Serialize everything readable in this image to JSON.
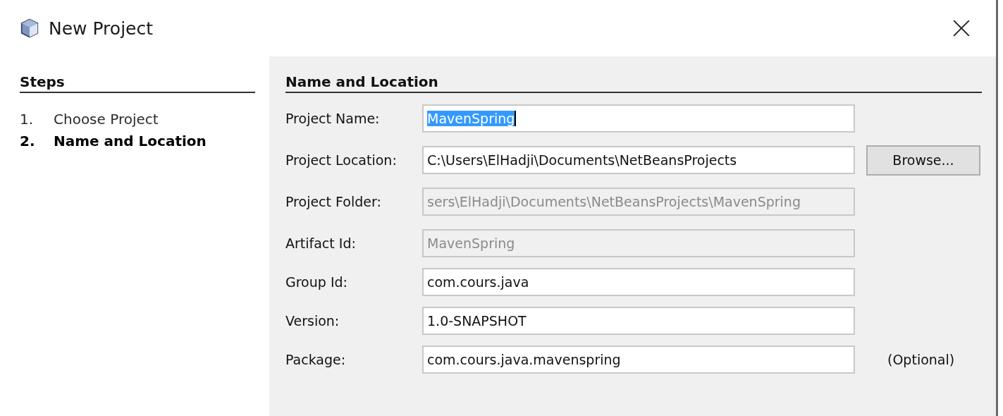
{
  "window": {
    "title": "New Project"
  },
  "steps": {
    "title": "Steps",
    "items": [
      {
        "number": "1.",
        "label": "Choose Project",
        "selected": false
      },
      {
        "number": "2.",
        "label": "Name and Location",
        "selected": true
      }
    ]
  },
  "panel": {
    "title": "Name and Location",
    "groups": [
      {
        "fields": [
          {
            "label": "Project Name:",
            "value": "MavenSpring",
            "disabled": false,
            "text_selected": true
          },
          {
            "label": "Project Location:",
            "value": "C:\\Users\\ElHadji\\Documents\\NetBeansProjects",
            "disabled": false,
            "text_selected": false,
            "button": "Browse..."
          },
          {
            "label": "Project Folder:",
            "value": "sers\\ElHadji\\Documents\\NetBeansProjects\\MavenSpring",
            "disabled": true,
            "text_selected": false
          }
        ]
      },
      {
        "fields": [
          {
            "label": "Artifact Id:",
            "value": "MavenSpring",
            "disabled": true,
            "text_selected": false
          },
          {
            "label": "Group Id:",
            "value": "com.cours.java",
            "disabled": false,
            "text_selected": false
          },
          {
            "label": "Version:",
            "value": "1.0-SNAPSHOT",
            "disabled": false,
            "text_selected": false
          },
          {
            "label": "Package:",
            "value": "com.cours.java.mavenspring",
            "disabled": false,
            "text_selected": false,
            "note": "(Optional)"
          }
        ]
      }
    ]
  }
}
